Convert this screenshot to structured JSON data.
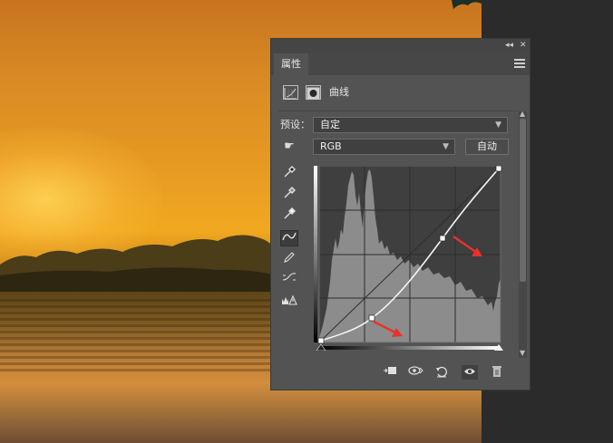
{
  "panel": {
    "tab_title": "属性",
    "adjustment_title": "曲线",
    "preset_label": "预设：",
    "preset_value": "自定",
    "channel_value": "RGB",
    "auto_button": "自动"
  },
  "icons": {
    "panel_controls": [
      "collapse-icon",
      "close-icon"
    ],
    "tools": [
      "sample-shadows-eyedropper-icon",
      "sample-midtones-eyedropper-icon",
      "sample-highlights-eyedropper-icon",
      "edit-points-curve-icon",
      "draw-pencil-icon",
      "smooth-curve-icon",
      "clipping-warning-icon"
    ],
    "footer": [
      "clip-to-layer-icon",
      "view-previous-state-icon",
      "reset-icon",
      "toggle-visibility-icon",
      "delete-icon"
    ]
  },
  "colors": {
    "panel_bg": "#535353",
    "arrow": "#e8322a"
  },
  "curve": {
    "channel": "RGB",
    "points": [
      [
        0,
        0
      ],
      [
        64,
        32
      ],
      [
        150,
        145
      ],
      [
        255,
        255
      ]
    ]
  }
}
